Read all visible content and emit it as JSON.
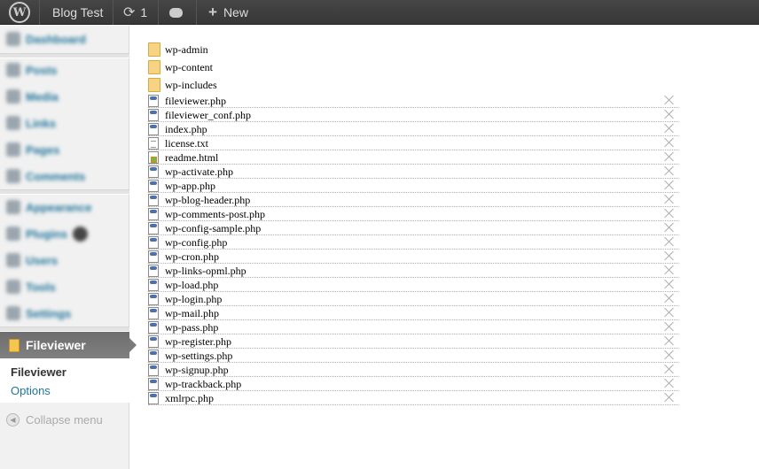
{
  "adminbar": {
    "site_name": "Blog Test",
    "updates_count": "1",
    "new_label": "New"
  },
  "sidebar": {
    "items": [
      {
        "label": "Dashboard"
      },
      {
        "label": "Posts"
      },
      {
        "label": "Media"
      },
      {
        "label": "Links"
      },
      {
        "label": "Pages"
      },
      {
        "label": "Comments"
      },
      {
        "label": "Appearance"
      },
      {
        "label": "Plugins"
      },
      {
        "label": "Users"
      },
      {
        "label": "Tools"
      },
      {
        "label": "Settings"
      }
    ],
    "current": {
      "label": "Fileviewer"
    },
    "submenu": [
      {
        "label": "Fileviewer"
      },
      {
        "label": "Options"
      }
    ],
    "collapse_label": "Collapse menu"
  },
  "filelist": {
    "folders": [
      "wp-admin",
      "wp-content",
      "wp-includes"
    ],
    "files": [
      {
        "name": "fileviewer.php",
        "type": "php"
      },
      {
        "name": "fileviewer_conf.php",
        "type": "php"
      },
      {
        "name": "index.php",
        "type": "php"
      },
      {
        "name": "license.txt",
        "type": "txt"
      },
      {
        "name": "readme.html",
        "type": "html"
      },
      {
        "name": "wp-activate.php",
        "type": "php"
      },
      {
        "name": "wp-app.php",
        "type": "php"
      },
      {
        "name": "wp-blog-header.php",
        "type": "php"
      },
      {
        "name": "wp-comments-post.php",
        "type": "php"
      },
      {
        "name": "wp-config-sample.php",
        "type": "php"
      },
      {
        "name": "wp-config.php",
        "type": "php"
      },
      {
        "name": "wp-cron.php",
        "type": "php"
      },
      {
        "name": "wp-links-opml.php",
        "type": "php"
      },
      {
        "name": "wp-load.php",
        "type": "php"
      },
      {
        "name": "wp-login.php",
        "type": "php"
      },
      {
        "name": "wp-mail.php",
        "type": "php"
      },
      {
        "name": "wp-pass.php",
        "type": "php"
      },
      {
        "name": "wp-register.php",
        "type": "php"
      },
      {
        "name": "wp-settings.php",
        "type": "php"
      },
      {
        "name": "wp-signup.php",
        "type": "php"
      },
      {
        "name": "wp-trackback.php",
        "type": "php"
      },
      {
        "name": "xmlrpc.php",
        "type": "php"
      }
    ]
  }
}
